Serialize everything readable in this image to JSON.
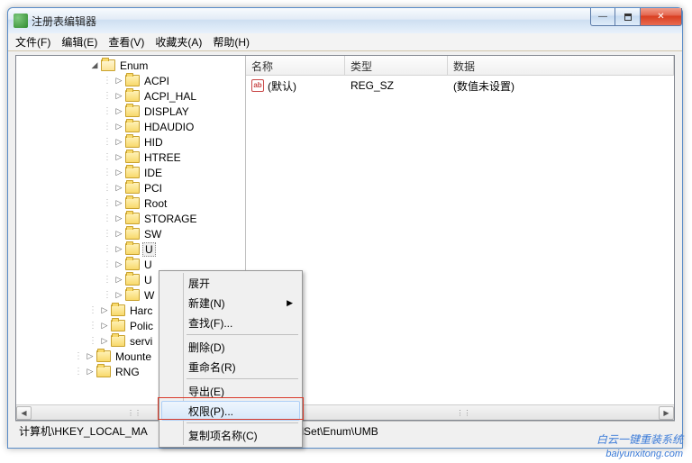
{
  "window": {
    "title": "注册表编辑器"
  },
  "menu": {
    "file": "文件(F)",
    "edit": "编辑(E)",
    "view": "查看(V)",
    "fav": "收藏夹(A)",
    "help": "帮助(H)"
  },
  "tree": {
    "root": "Enum",
    "items": [
      "ACPI",
      "ACPI_HAL",
      "DISPLAY",
      "HDAUDIO",
      "HID",
      "HTREE",
      "IDE",
      "PCI",
      "Root",
      "STORAGE",
      "SW"
    ],
    "u_items": [
      "U",
      "U",
      "U",
      "W"
    ],
    "bottom": [
      "Harc",
      "Polic",
      "servi",
      "Mounte",
      "RNG"
    ]
  },
  "list": {
    "cols": {
      "name": "名称",
      "type": "类型",
      "data": "数据"
    },
    "row": {
      "name": "(默认)",
      "type": "REG_SZ",
      "data": "(数值未设置)"
    }
  },
  "context": {
    "expand": "展开",
    "new": "新建(N)",
    "find": "查找(F)...",
    "delete": "删除(D)",
    "rename": "重命名(R)",
    "export": "导出(E)",
    "perm": "权限(P)...",
    "copy": "复制项名称(C)"
  },
  "status": "计算机\\HKEY_LOCAL_MA",
  "status_end": "rolSet\\Enum\\UMB",
  "watermark": {
    "line1": "白云一键重装系统",
    "line2": "baiyunxitong.com"
  }
}
